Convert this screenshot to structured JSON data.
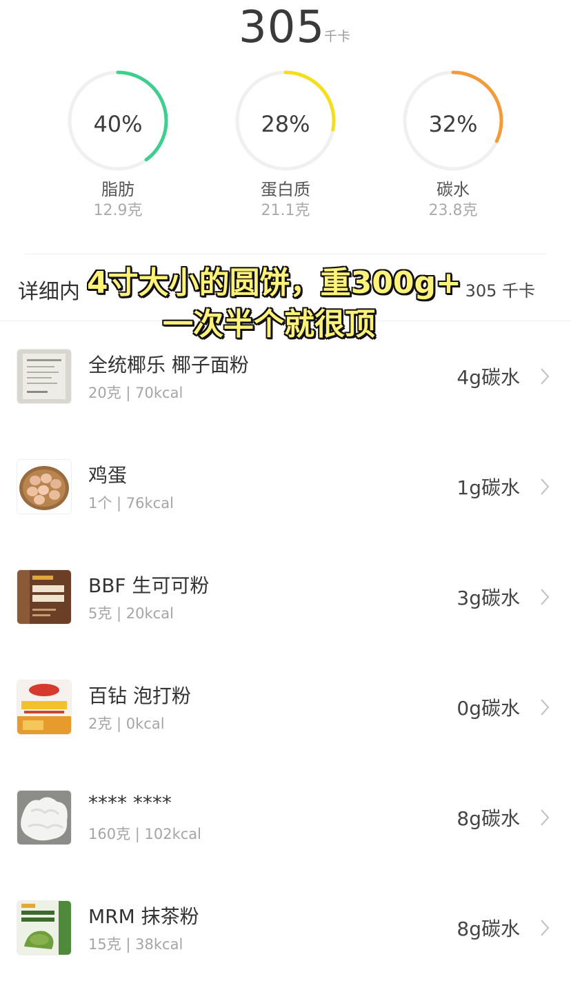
{
  "total": {
    "value": "305",
    "unit": "千卡"
  },
  "macros": [
    {
      "percent": "40%",
      "name": "脂肪",
      "grams": "12.9克",
      "fraction": 0.4,
      "color": "#3ecf8e"
    },
    {
      "percent": "28%",
      "name": "蛋白质",
      "grams": "21.1克",
      "fraction": 0.28,
      "color": "#f5df1b"
    },
    {
      "percent": "32%",
      "name": "碳水",
      "grams": "23.8克",
      "fraction": 0.32,
      "color": "#f39a3b"
    }
  ],
  "details": {
    "title": "详细内",
    "kcal": "305 千卡"
  },
  "overlay": {
    "line1": "4寸大小的圆饼，重300g+",
    "line2": "一次半个就很顶"
  },
  "foods": [
    {
      "name": "全统椰乐 椰子面粉",
      "meta": "20克 | 70kcal",
      "carb": "4g碳水",
      "thumb": "coconut-flour"
    },
    {
      "name": "鸡蛋",
      "meta": "1个 | 76kcal",
      "carb": "1g碳水",
      "thumb": "eggs"
    },
    {
      "name": "BBF 生可可粉",
      "meta": "5克 | 20kcal",
      "carb": "3g碳水",
      "thumb": "cacao"
    },
    {
      "name": "百钻 泡打粉",
      "meta": "2克 | 0kcal",
      "carb": "0g碳水",
      "thumb": "baking-powder"
    },
    {
      "name": "**** ****",
      "meta": "160克 | 102kcal",
      "carb": "8g碳水",
      "thumb": "yogurt"
    },
    {
      "name": "MRM 抹茶粉",
      "meta": "15克 | 38kcal",
      "carb": "8g碳水",
      "thumb": "matcha"
    }
  ]
}
